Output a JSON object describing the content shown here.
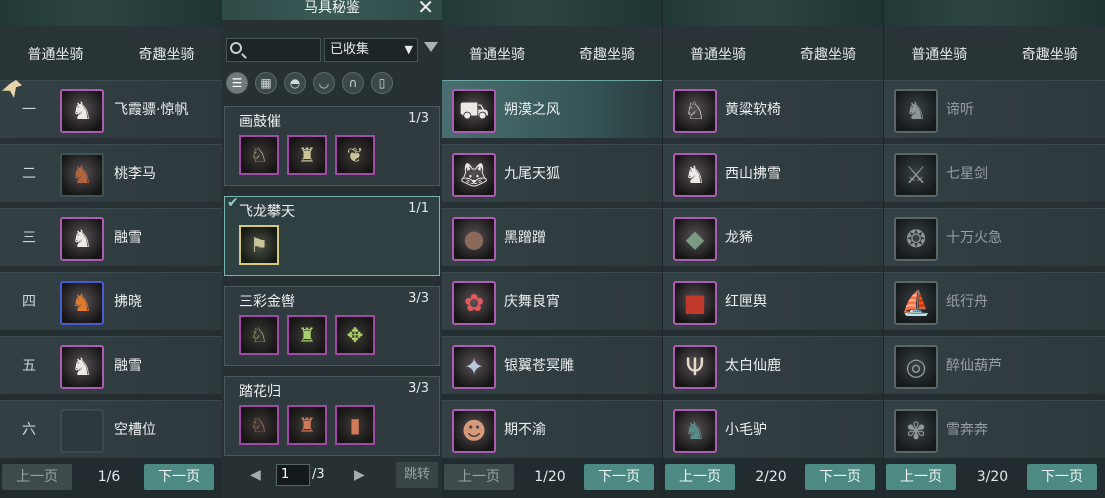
{
  "window": {
    "title": "马具秘鉴",
    "close_icon": "close-icon"
  },
  "panel1": {
    "tabs": [
      "普通坐骑",
      "奇趣坐骑"
    ],
    "items": [
      {
        "num": "一",
        "name": "飞霞骠·惊帆",
        "icon": "white-horse-icon",
        "selected": true
      },
      {
        "num": "二",
        "name": "桃李马",
        "icon": "brown-horse-icon"
      },
      {
        "num": "三",
        "name": "融雪",
        "icon": "white-horse-icon"
      },
      {
        "num": "四",
        "name": "拂晓",
        "icon": "orange-horse-icon"
      },
      {
        "num": "五",
        "name": "融雪",
        "icon": "white-horse-icon"
      },
      {
        "num": "六",
        "name": "空槽位",
        "icon": "empty-slot-icon"
      }
    ],
    "prev": "上一页",
    "page": "1/6",
    "next": "下一页"
  },
  "collection": {
    "search_placeholder": "",
    "filter_value": "已收集",
    "categories": [
      "list-icon",
      "grid-icon",
      "saddle-icon",
      "armor-icon",
      "horseshoe-icon",
      "stirrup-icon"
    ],
    "sets": [
      {
        "name": "画鼓催",
        "count": "1/3",
        "slots": 3
      },
      {
        "name": "飞龙攀天",
        "count": "1/1",
        "slots": 1,
        "selected": true
      },
      {
        "name": "三彩金辔",
        "count": "3/3",
        "slots": 3
      },
      {
        "name": "踏花归",
        "count": "3/3",
        "slots": 3
      }
    ],
    "page_value": "1",
    "page_total": "/3",
    "jump": "跳转"
  },
  "panel2": {
    "tabs": [
      "普通坐骑",
      "奇趣坐骑"
    ],
    "items": [
      "朔漠之风",
      "九尾天狐",
      "黑蹭蹭",
      "庆舞良宵",
      "银翼苍冥雕",
      "期不渝"
    ],
    "prev": "上一页",
    "page": "1/20",
    "next": "下一页"
  },
  "panel3": {
    "tabs": [
      "普通坐骑",
      "奇趣坐骑"
    ],
    "items": [
      "黄粱软椅",
      "西山拂雪",
      "龙豨",
      "红匣舆",
      "太白仙鹿",
      "小毛驴"
    ],
    "prev": "上一页",
    "page": "2/20",
    "next": "下一页"
  },
  "panel4": {
    "tabs": [
      "普通坐骑",
      "奇趣坐骑"
    ],
    "items": [
      "谛听",
      "七星剑",
      "十万火急",
      "纸行舟",
      "醉仙葫芦",
      "雪奔奔"
    ],
    "prev": "上一页",
    "page": "3/20",
    "next": "下一页"
  }
}
